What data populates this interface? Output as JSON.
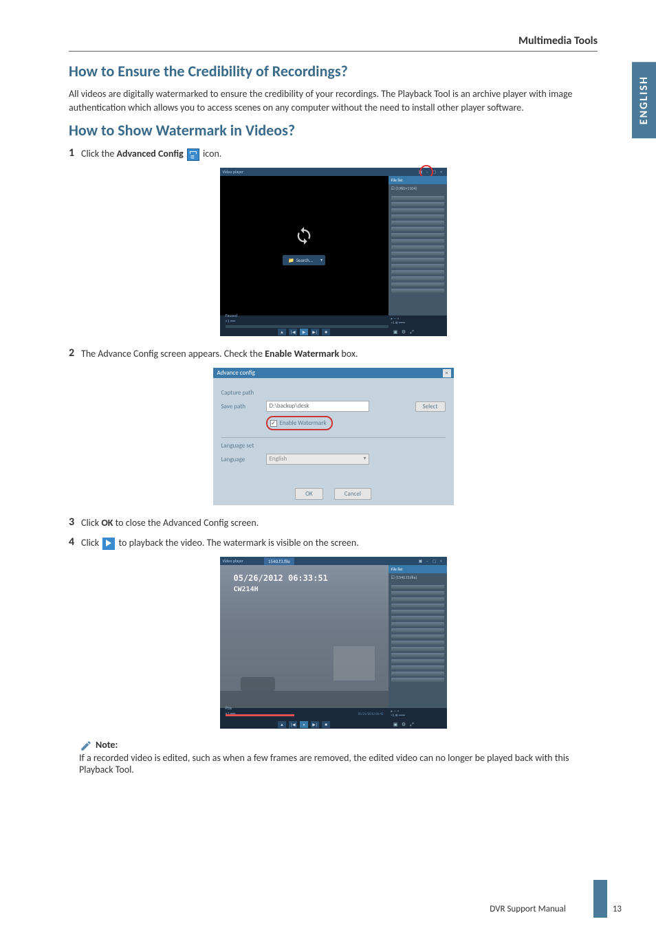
{
  "section_header": "Multimedia Tools",
  "lang_tab": "ENGLISH",
  "h2_credibility": "How to Ensure the Credibility of Recordings?",
  "p_credibility": "All videos are digitally watermarked to ensure the credibility of your recordings. The Playback Tool is an archive player with image authentication which allows you to access scenes on any computer without the need to install other player software.",
  "h2_watermark": "How to Show Watermark in Videos?",
  "step1": {
    "num": "1",
    "pre": "Click the ",
    "bold": "Advanced Config",
    "post": " icon."
  },
  "fig1": {
    "title": "Video player",
    "search": "Search...",
    "side_top": "File list",
    "side_check": "☑ (1960×1104)",
    "status": "Paused"
  },
  "step2": {
    "num": "2",
    "pre": "The Advance Config screen appears. Check the ",
    "bold": "Enable Watermark",
    "post": " box."
  },
  "fig2": {
    "title": "Advance config",
    "capture_path": "Capture path",
    "save_path": "Save path",
    "save_path_value": "D:\\backup\\desk",
    "select": "Select",
    "checkbox": "Enable Watermark",
    "language_set": "Language set",
    "language": "Language",
    "language_value": "English",
    "ok": "OK",
    "cancel": "Cancel"
  },
  "step3": {
    "num": "3",
    "pre": "Click ",
    "bold": "OK",
    "post": " to close the Advanced Config screen."
  },
  "step4": {
    "num": "4",
    "pre": "Click ",
    "post": " to playback the video. The watermark is visible on the screen."
  },
  "fig3": {
    "title": "Video player",
    "file": "1540.f3.file",
    "timestamp": "05/26/2012 06:33:51",
    "device_id": "CW214H",
    "bottom_time": "05/22/2012 06:42",
    "side_top": "File list",
    "side_check": "☑ (1540.f3.file)",
    "status": "Play"
  },
  "note": {
    "title": "Note:",
    "text": "If a recorded video is edited, such as when a few frames are removed, the edited video can no longer be played back with this Playback Tool."
  },
  "footer": {
    "text": "DVR Support Manual",
    "page": "13"
  }
}
